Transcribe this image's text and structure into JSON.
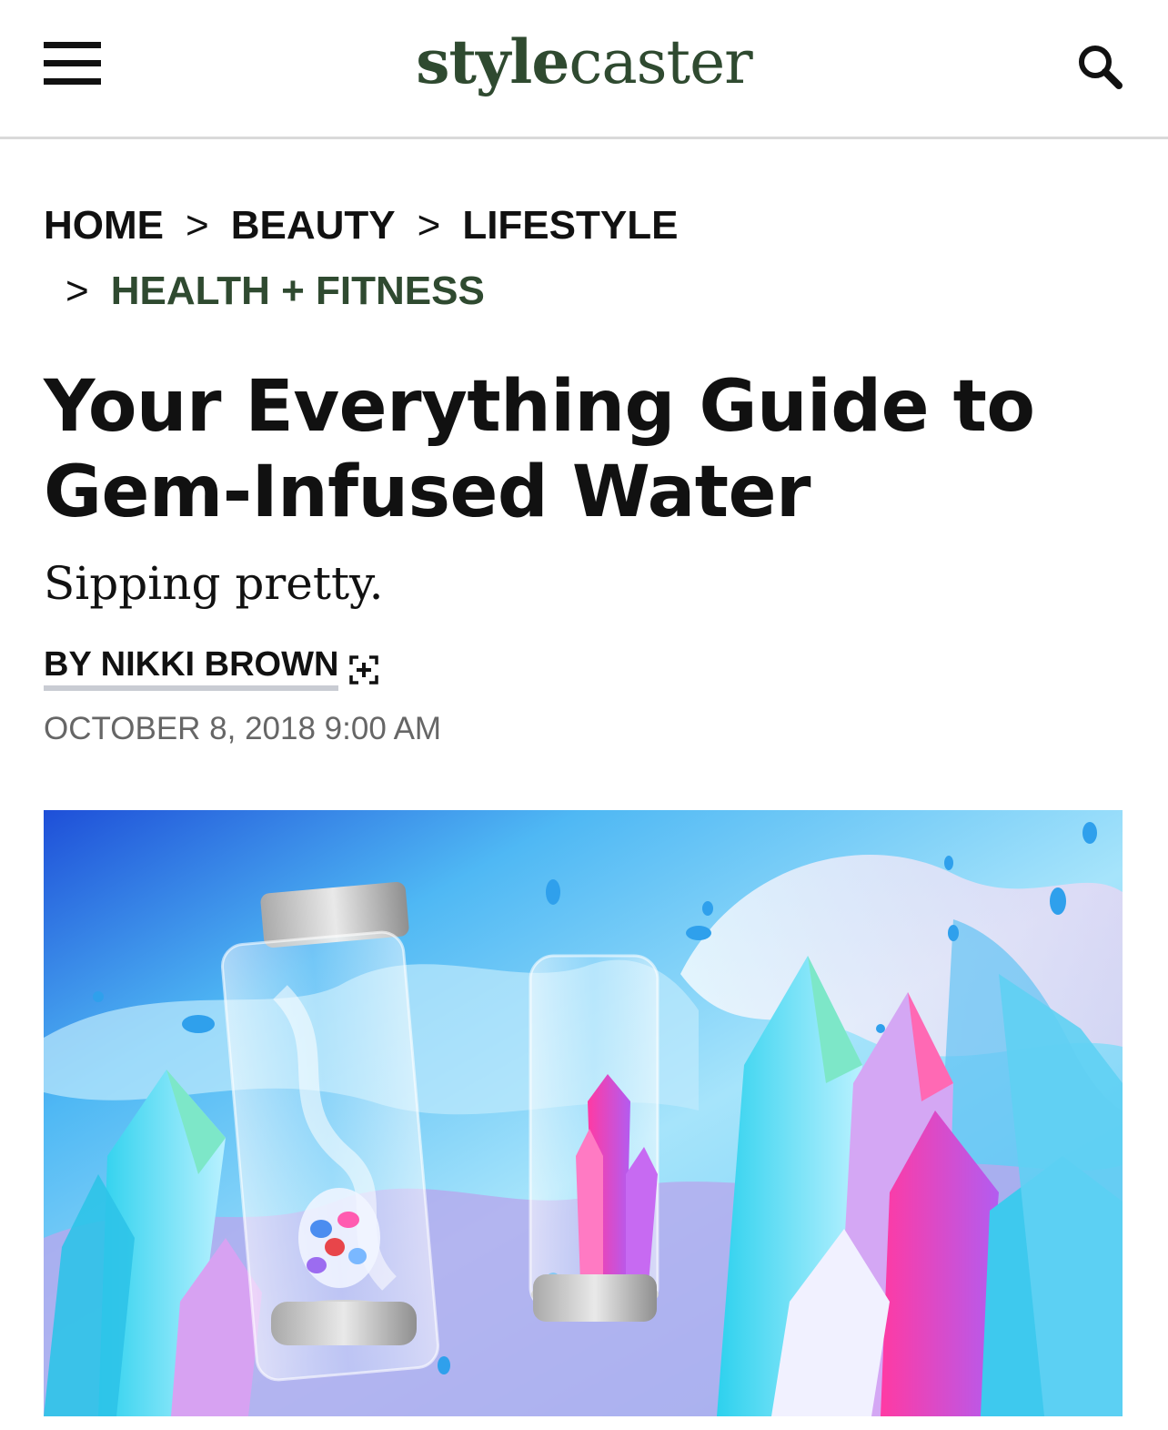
{
  "header": {
    "logo_bold": "style",
    "logo_light": "caster"
  },
  "breadcrumb": {
    "items": [
      "HOME",
      "BEAUTY",
      "LIFESTYLE",
      "HEALTH + FITNESS"
    ],
    "separator": ">"
  },
  "article": {
    "title": "Your Everything Guide to Gem-Infused Water",
    "dek": "Sipping pretty.",
    "byline": "BY NIKKI BROWN",
    "date": "OCTOBER 8, 2018 9:00 AM"
  },
  "icons": {
    "menu": "hamburger-menu-icon",
    "search": "search-icon",
    "follow": "add-author-icon"
  },
  "colors": {
    "brand_green": "#2f4a30",
    "date_gray": "#666666",
    "divider": "#d9d9d9"
  }
}
